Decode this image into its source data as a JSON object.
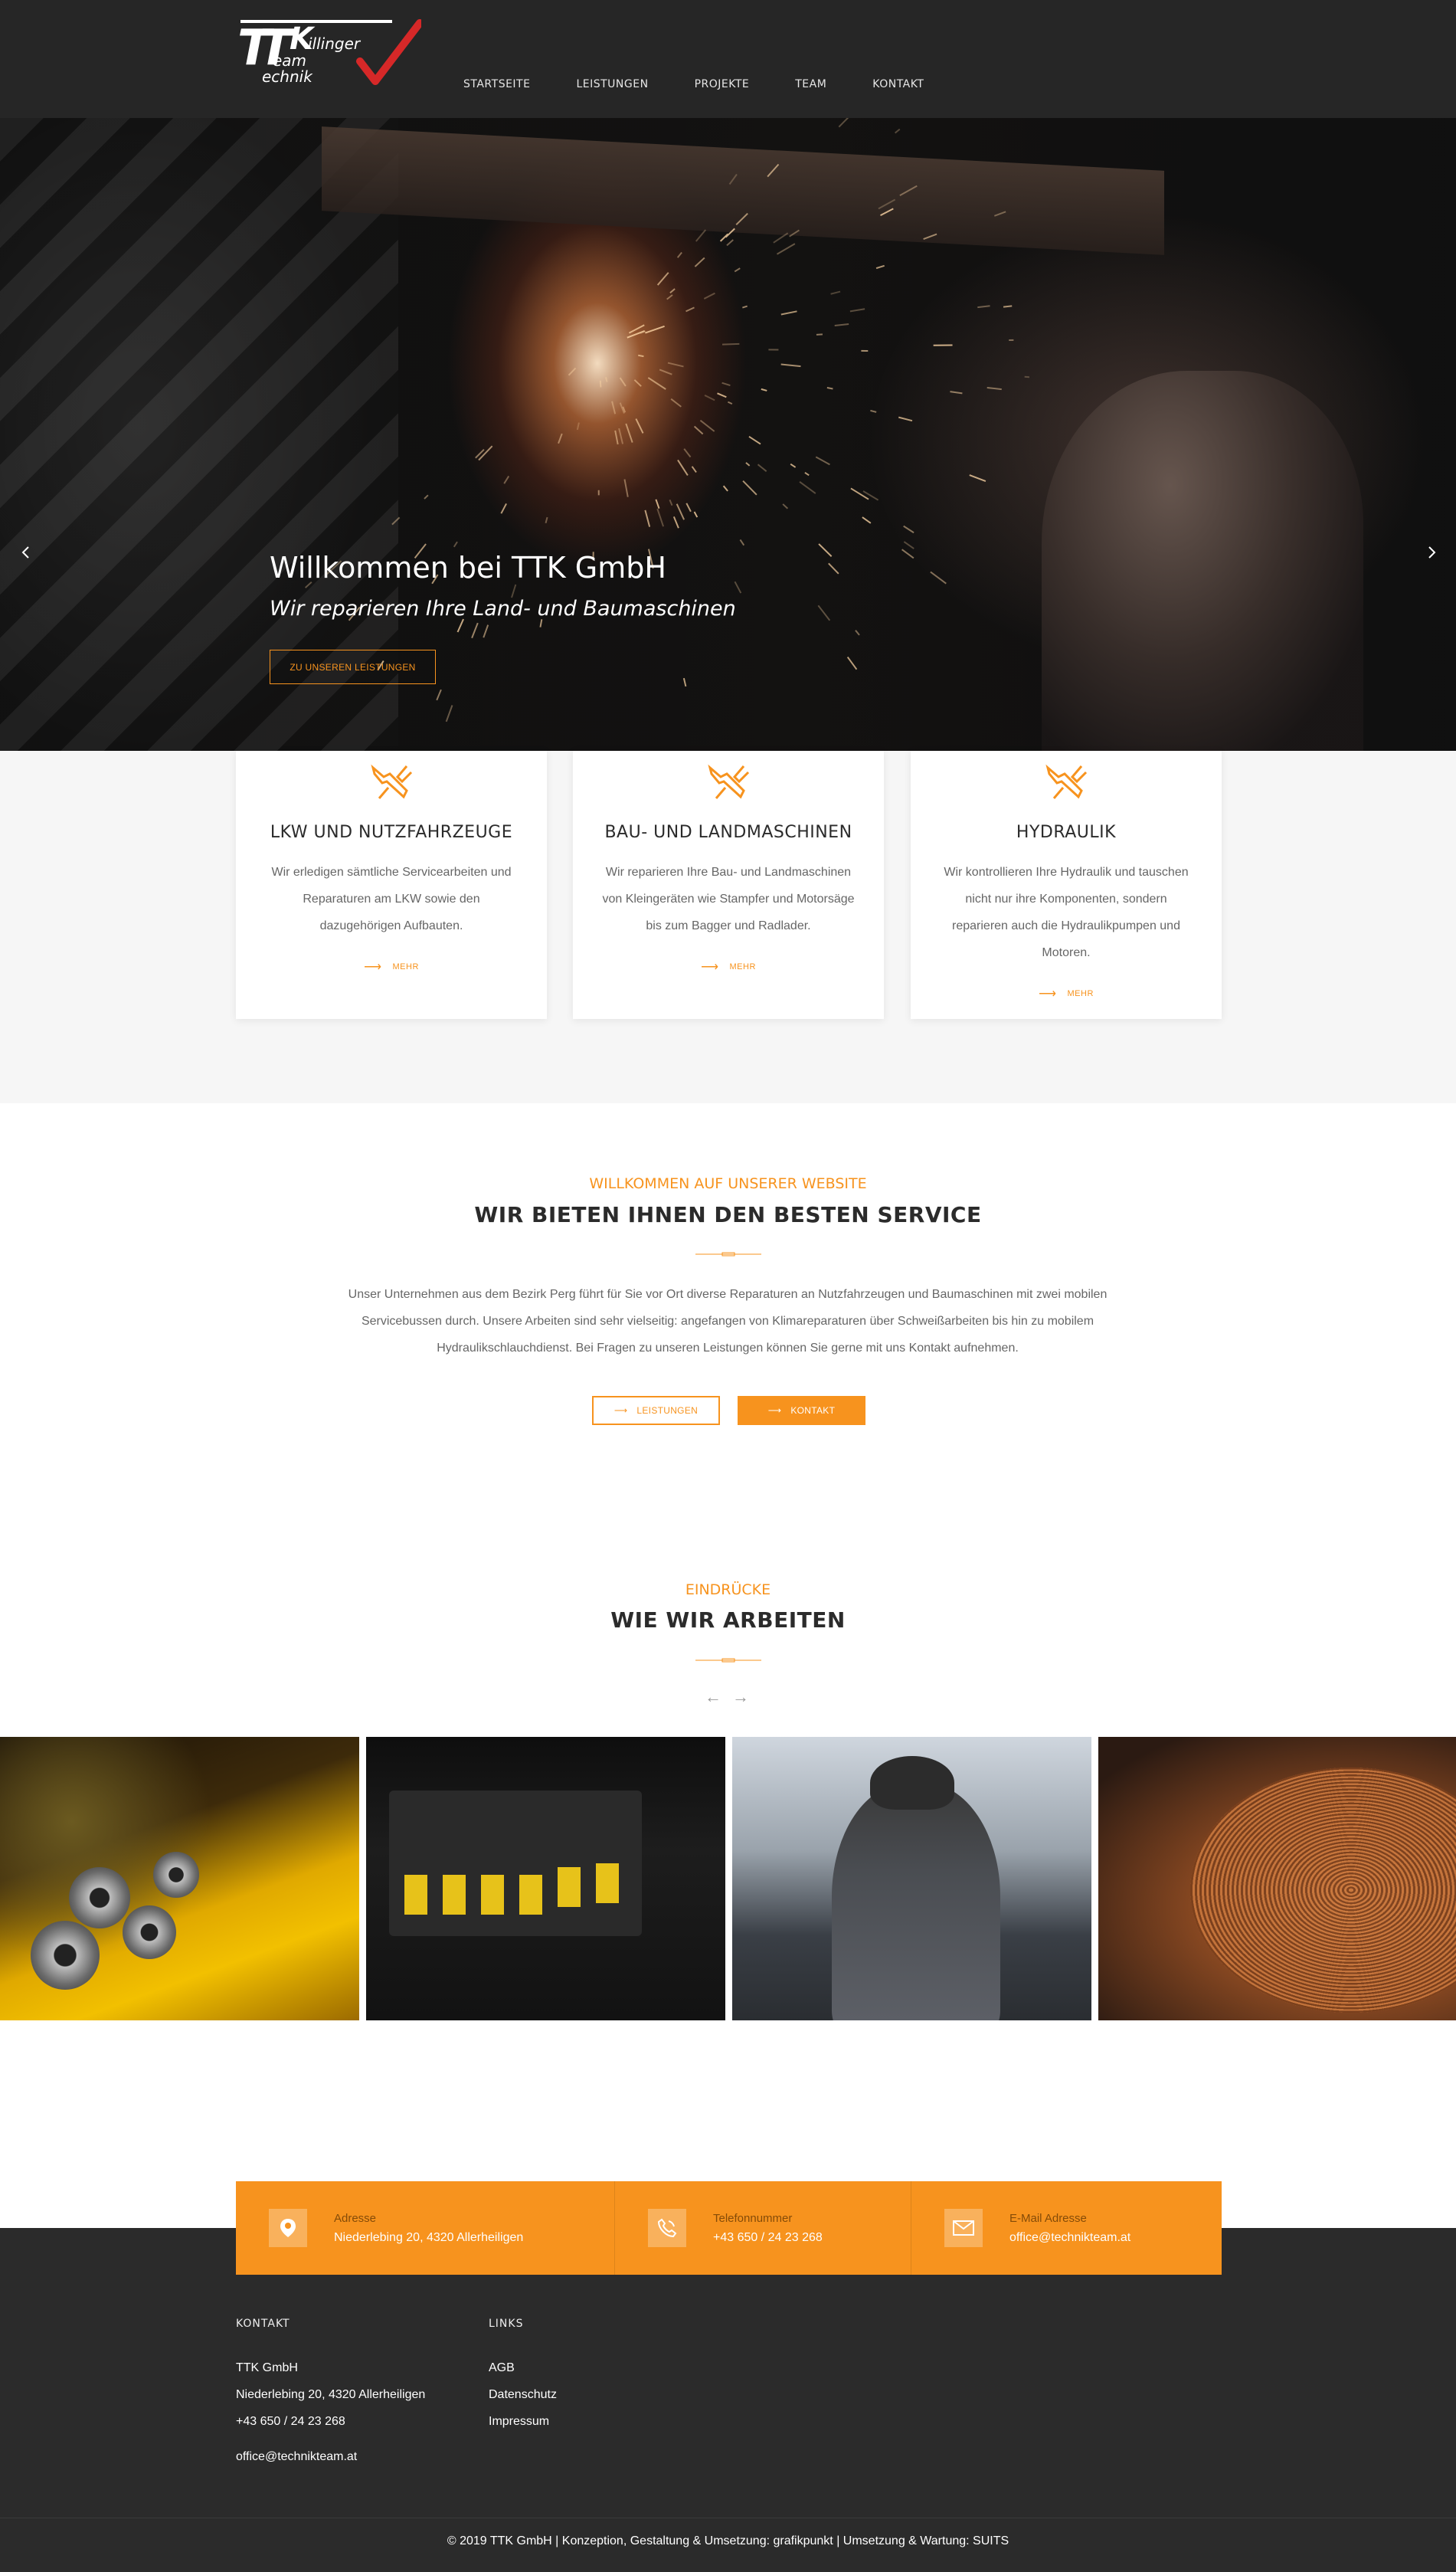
{
  "header": {
    "logo_text": "Team Technik Killinger TTK",
    "nav": [
      "STARTSEITE",
      "LEISTUNGEN",
      "PROJEKTE",
      "TEAM",
      "KONTAKT"
    ]
  },
  "hero": {
    "title": "Willkommen bei TTK GmbH",
    "subtitle": "Wir reparieren Ihre Land- und Baumaschinen",
    "button": "ZU UNSEREN LEISTUNGEN",
    "prev_icon": "chevron-left-icon",
    "next_icon": "chevron-right-icon"
  },
  "services": [
    {
      "icon": "wrench-icon",
      "title": "LKW UND NUTZFAHRZEUGE",
      "text": "Wir erledigen sämtliche Servicearbeiten und Reparaturen am LKW sowie den dazugehörigen Aufbauten.",
      "more": "MEHR"
    },
    {
      "icon": "wrench-icon",
      "title": "BAU- UND LANDMASCHINEN",
      "text": "Wir reparieren Ihre Bau- und Landmaschinen von Kleingeräten wie Stampfer und Motorsäge bis zum Bagger und Radlader.",
      "more": "MEHR"
    },
    {
      "icon": "wrench-icon",
      "title": "HYDRAULIK",
      "text": "Wir kontrollieren Ihre Hydraulik und tauschen nicht nur ihre Komponenten, sondern reparieren auch die Hydraulikpumpen und Motoren.",
      "more": "MEHR"
    }
  ],
  "welcome": {
    "eyebrow": "WILLKOMMEN AUF UNSERER WEBSITE",
    "title": "WIR BIETEN IHNEN DEN BESTEN SERVICE",
    "text": "Unser Unternehmen aus dem Bezirk Perg führt für Sie vor Ort diverse Reparaturen an Nutzfahrzeugen und Baumaschinen mit zwei mobilen Servicebussen durch. Unsere Arbeiten sind sehr vielseitig: angefangen von Klimareparaturen über Schweißarbeiten bis hin zu mobilem Hydraulikschlauchdienst. Bei Fragen zu unseren Leistungen können Sie gerne mit uns Kontakt aufnehmen.",
    "btn_services": "LEISTUNGEN",
    "btn_contact": "KONTAKT"
  },
  "impressions": {
    "eyebrow": "EINDRÜCKE",
    "title": "WIE WIR ARBEITEN",
    "prev": "←",
    "next": "→"
  },
  "contact_bar": [
    {
      "icon": "map-pin-icon",
      "label": "Adresse",
      "value": "Niederlebing 20, 4320 Allerheiligen"
    },
    {
      "icon": "phone-icon",
      "label": "Telefonnummer",
      "value": "+43 650 / 24 23 268"
    },
    {
      "icon": "mail-icon",
      "label": "E-Mail Adresse",
      "value": "office@technikteam.at"
    }
  ],
  "footer": {
    "kontakt_title": "KONTAKT",
    "company": "TTK GmbH",
    "address": "Niederlebing 20, 4320 Allerheiligen",
    "phone": "+43 650 / 24 23 268",
    "email": "office@technikteam.at",
    "links_title": "LINKS",
    "links": [
      "AGB",
      "Datenschutz",
      "Impressum"
    ],
    "copyright": "© 2019 TTK GmbH | Konzeption, Gestaltung & Umsetzung: grafikpunkt | Umsetzung & Wartung: SUITS"
  },
  "colors": {
    "accent": "#f7931e",
    "dark": "#262626",
    "logo_red": "#d62828"
  }
}
